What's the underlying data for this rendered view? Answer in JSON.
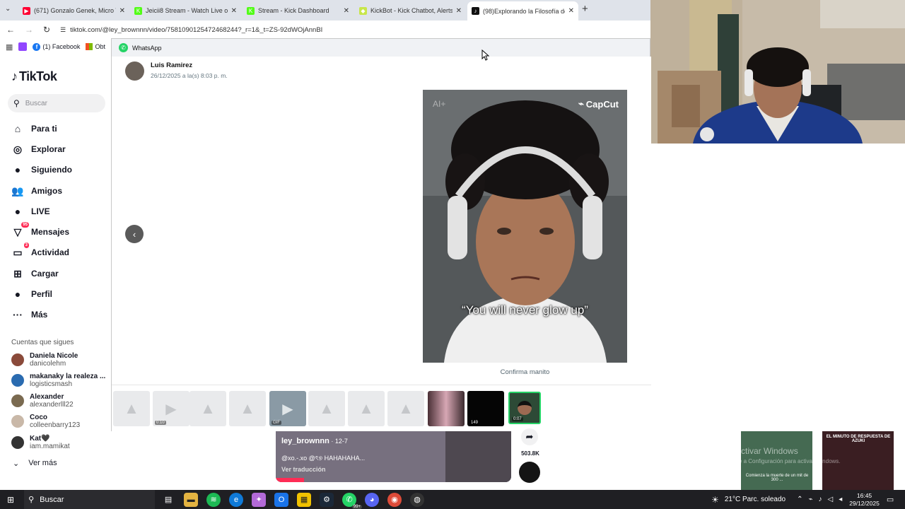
{
  "browser": {
    "tabs": [
      {
        "title": "(671) Gonzalo Genek, Micro TD",
        "color": "#ff0033",
        "glyph": "▶"
      },
      {
        "title": "Jeicii8 Stream - Watch Live on K",
        "color": "#53fc18",
        "glyph": "K"
      },
      {
        "title": "Stream - Kick Dashboard",
        "color": "#53fc18",
        "glyph": "K"
      },
      {
        "title": "KickBot - Kick Chatbot, Alerts, T",
        "color": "#c8e64a",
        "glyph": "◆"
      },
      {
        "title": "(98)Explorando la Filosofía de D",
        "color": "#111111",
        "glyph": "♪"
      }
    ],
    "new_tab": "+",
    "url": "tiktok.com/@ley_brownnn/video/7581090125472468244?_r=1&_t=ZS-92dWOjAnnBI",
    "bookmarks": [
      {
        "label": "",
        "icon": "twitch-icon"
      },
      {
        "label": "(1) Facebook",
        "icon": "facebook-icon"
      },
      {
        "label": "Obt",
        "icon": "windows-icon"
      }
    ]
  },
  "tiktok": {
    "logo": "TikTok",
    "search_placeholder": "Buscar",
    "nav": [
      {
        "label": "Para ti",
        "icon": "home-icon",
        "glyph": "⌂",
        "badge": ""
      },
      {
        "label": "Explorar",
        "icon": "compass-icon",
        "glyph": "◎",
        "badge": ""
      },
      {
        "label": "Siguiendo",
        "icon": "following-icon",
        "glyph": "●",
        "badge": ""
      },
      {
        "label": "Amigos",
        "icon": "friends-icon",
        "glyph": "👥",
        "badge": ""
      },
      {
        "label": "LIVE",
        "icon": "live-icon",
        "glyph": "●",
        "badge": ""
      },
      {
        "label": "Mensajes",
        "icon": "messages-icon",
        "glyph": "▽",
        "badge": "95"
      },
      {
        "label": "Actividad",
        "icon": "activity-icon",
        "glyph": "▭",
        "badge": "3"
      },
      {
        "label": "Cargar",
        "icon": "upload-icon",
        "glyph": "⊞",
        "badge": ""
      },
      {
        "label": "Perfil",
        "icon": "profile-icon",
        "glyph": "●",
        "badge": ""
      },
      {
        "label": "Más",
        "icon": "more-icon",
        "glyph": "···",
        "badge": ""
      }
    ],
    "following_title": "Cuentas que sigues",
    "following": [
      {
        "name": "Daniela Nicole",
        "handle": "danicolehm",
        "color": "#8a4a3a"
      },
      {
        "name": "makanaky la realeza ...",
        "handle": "logisticsmash",
        "color": "#2a6bb0"
      },
      {
        "name": "Alexander",
        "handle": "alexanderlll22",
        "color": "#7a6a50"
      },
      {
        "name": "Coco",
        "handle": "colleenbarry123",
        "color": "#c9b8a8"
      },
      {
        "name": "Kat🖤",
        "handle": "iam.mamikat",
        "color": "#333333"
      }
    ],
    "see_more": "Ver más",
    "feed": {
      "author": "ley_brownnn",
      "date": "12-7",
      "caption": "@xo.-.xo @ৎ୭ HAHAHAHA...",
      "translate": "Ver traducción",
      "share_count": "503.8K"
    },
    "side_thumbs": [
      {
        "text": "EL MINUTO DE RESPUESTA DE AZUKI"
      },
      {
        "text": "Comienza la muerte de un mit de 300 ..."
      }
    ],
    "watermark": "Activar Windows",
    "watermark_sub": "Ve a Configuración para activar Windows."
  },
  "whatsapp": {
    "title": "WhatsApp",
    "sender_name": "Luis Ramirez",
    "sender_date": "26/12/2025 a la(s) 8:03 p. m.",
    "video_caption": "“You will never glow up”",
    "capcut_logo": "CapCut",
    "ai_mark": "AI+",
    "message_caption": "Confirma  manito",
    "prev_arrow": "‹",
    "thumbnails": [
      {
        "type": "image",
        "label": ""
      },
      {
        "type": "video",
        "label": "0:10"
      },
      {
        "type": "image",
        "label": ""
      },
      {
        "type": "image",
        "label": ""
      },
      {
        "type": "video-gif",
        "label": "GIF"
      },
      {
        "type": "image",
        "label": ""
      },
      {
        "type": "image",
        "label": ""
      },
      {
        "type": "image",
        "label": ""
      },
      {
        "type": "photo",
        "label": ""
      },
      {
        "type": "dark",
        "label": "149"
      },
      {
        "type": "selected",
        "label": "0:07"
      }
    ]
  },
  "taskbar": {
    "search": "Buscar",
    "weather": "21°C  Parc. soleado",
    "time": "16:45",
    "date": "29/12/2025",
    "whatsapp_badge": "99+"
  }
}
